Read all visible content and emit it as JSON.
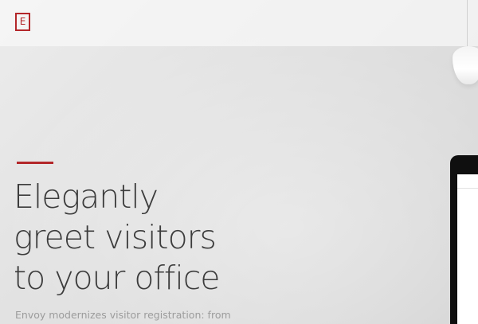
{
  "header": {
    "logo_letter": "E"
  },
  "hero": {
    "headline_lines": [
      "Elegantly",
      "greet visitors",
      "to your office"
    ],
    "subtext": "Envoy modernizes visitor registration: from"
  },
  "colors": {
    "accent": "#b3272a",
    "headline": "#3c3c3c",
    "subtext": "#9c9c9c"
  },
  "icons": {
    "logo": "envoy-logo-icon",
    "lamp": "pendant-lamp-image",
    "device": "tablet-device-image"
  }
}
